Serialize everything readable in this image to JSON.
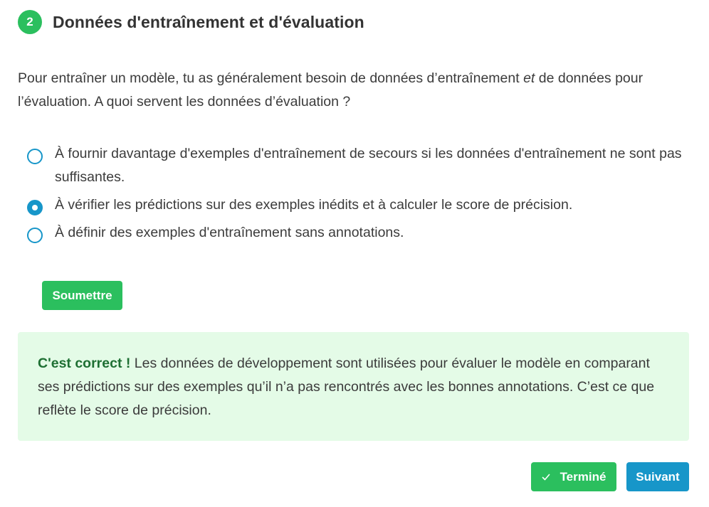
{
  "header": {
    "step_number": "2",
    "title": "Données d'entraînement et d'évaluation"
  },
  "question": {
    "part1": "Pour entraîner un modèle, tu as généralement besoin de données d’entraînement ",
    "emphasis": "et",
    "part2": " de données pour l’évaluation. A quoi servent les données d’évaluation ?"
  },
  "options": [
    {
      "label": "À fournir davantage d'exemples d'entraînement de secours si les données d'entraînement ne sont pas suffisantes.",
      "selected": false
    },
    {
      "label": "À vérifier les prédictions sur des exemples inédits et à calculer le score de précision.",
      "selected": true
    },
    {
      "label": "À définir des exemples d'entraînement sans annotations.",
      "selected": false
    }
  ],
  "submit_label": "Soumettre",
  "feedback": {
    "strong": "C'est correct !",
    "text": " Les données de développement sont utilisées pour évaluer le modèle en comparant ses prédictions sur des exemples qu’il n’a pas rencontrés avec les bonnes annotations. C’est ce que reflète le score de précision."
  },
  "footer": {
    "done_label": "Terminé",
    "next_label": "Suivant"
  },
  "colors": {
    "green": "#2bbf5e",
    "blue": "#1796c9",
    "feedback_bg": "#e4fbe7",
    "feedback_strong": "#1e6f33"
  },
  "icons": {
    "done": "check-icon"
  }
}
